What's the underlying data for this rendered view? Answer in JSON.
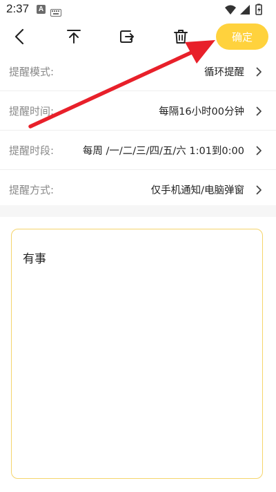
{
  "status_bar": {
    "time": "2:37",
    "notification_letter": "A"
  },
  "toolbar": {
    "confirm_label": "确定"
  },
  "settings": [
    {
      "label": "提醒模式:",
      "value": "循环提醒"
    },
    {
      "label": "提醒时间:",
      "value": "每隔16小时00分钟"
    },
    {
      "label": "提醒时段:",
      "value": "每周 /一/二/三/四/五/六 1:01到0:00"
    },
    {
      "label": "提醒方式:",
      "value": "仅手机通知/电脑弹窗"
    }
  ],
  "note": {
    "text": "有事"
  },
  "colors": {
    "accent": "#ffd23d",
    "arrow": "#e8202a",
    "border": "#f5d46a"
  }
}
